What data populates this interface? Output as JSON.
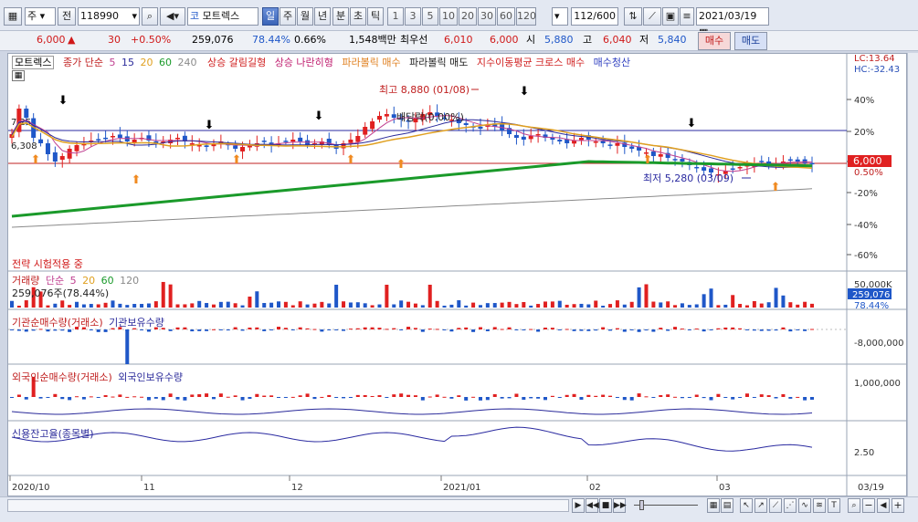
{
  "toolbar": {
    "market": "주",
    "prev_label": "전",
    "code": "118990",
    "exchange_icon": "코",
    "stock_name": "모트렉스",
    "periods": [
      "일",
      "주",
      "월",
      "년",
      "분",
      "초",
      "틱"
    ],
    "selected_period": "일",
    "intervals": [
      "1",
      "3",
      "5",
      "10",
      "20",
      "30",
      "60",
      "120"
    ],
    "count": "112/600",
    "date": "2021/03/19"
  },
  "quote": {
    "price": "6,000",
    "arrow": "▲",
    "change": "30",
    "change_pct": "+0.50%",
    "volume": "259,076",
    "volume_ratio": "78.44%",
    "turnover": "0.66%",
    "amount": "1,548백만",
    "ask_label": "최우선",
    "ask": "6,010",
    "bid": "6,000",
    "open_label": "시",
    "open": "5,880",
    "high_label": "고",
    "high": "6,040",
    "low_label": "저",
    "low": "5,840",
    "buy_label": "매수",
    "sell_label": "매도"
  },
  "price_pane": {
    "name": "모트렉스",
    "ma_label": "종가 단순",
    "ma_periods": [
      "5",
      "15",
      "20",
      "60",
      "240"
    ],
    "signals": [
      "상승 갈림길형",
      "상승 나란히형",
      "파라볼릭 매수",
      "파라볼릭 매도",
      "지수이동평균 크로스 매수",
      "매수청산"
    ],
    "lc": "LC:13.64",
    "hc": "HC:-32.43",
    "high_note": "최고 8,880 (01/08)",
    "low_note": "최저 5,280 (03/09)",
    "dividend_note": "배당락(0.00%)",
    "level_725": "7,25",
    "level_6308": "6,308",
    "current_price_tag": "6,000",
    "current_pct_tag": "0.50%",
    "pct_ticks": [
      "40%",
      "20%",
      "0%",
      "-20%",
      "-40%",
      "-60%"
    ],
    "strategy": "전략 시험적용 중"
  },
  "volume_pane": {
    "name": "거래량",
    "ma_label": "단순",
    "ma_periods": [
      "5",
      "20",
      "60",
      "120"
    ],
    "value_note": "259,076주(78.44%)",
    "tick": "50,000K",
    "tag_value": "259,076",
    "tag_pct": "78.44%"
  },
  "inst_pane": {
    "name": "기관순매수량(거래소)",
    "name2": "기관보유수량",
    "tick": "-8,000,000"
  },
  "foreign_pane": {
    "name": "외국인순매수량(거래소)",
    "name2": "외국인보유수량",
    "tick": "1,000,000"
  },
  "credit_pane": {
    "name": "신용잔고율(종목별)",
    "tick": "2.50"
  },
  "x_axis": [
    "2020/10",
    "11",
    "12",
    "2021/01",
    "02",
    "03",
    "03/19"
  ],
  "colors": {
    "up": "#e02020",
    "down": "#1f57c8",
    "ma5": "#c04090",
    "ma15": "#2a2a9a",
    "ma20": "#e0a020",
    "ma60": "#1a9a2a",
    "ma240": "#8a8a8a"
  }
}
